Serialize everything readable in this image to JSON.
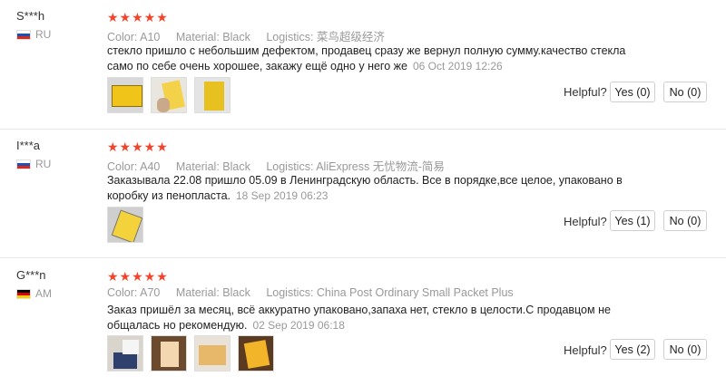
{
  "reviews": [
    {
      "buyer": "S***h",
      "country": "RU",
      "stars": "★★★★★",
      "color": "Color: A10",
      "material": "Material: Black",
      "logistics": "Logistics: 菜鸟超级经济",
      "text": "стекло пришло с небольшим дефектом, продавец сразу же вернул полную сумму.качество стекла само по себе очень хорошее, закажу ещё одно у него же",
      "date": "06 Oct 2019 12:26",
      "helpful": "Helpful?",
      "yes": "Yes (0)",
      "no": "No (0)"
    },
    {
      "buyer": "I***a",
      "country": "RU",
      "stars": "★★★★★",
      "color": "Color: A40",
      "material": "Material: Black",
      "logistics": "Logistics: AliExpress 无忧物流-简易",
      "text": "Заказывала 22.08 пришло 05.09 в Ленинградскую область. Все в порядке,все целое, упаковано в коробку из пенопласта.",
      "date": "18 Sep 2019 06:23",
      "helpful": "Helpful?",
      "yes": "Yes (1)",
      "no": "No (0)"
    },
    {
      "buyer": "G***n",
      "country": "AM",
      "stars": "★★★★★",
      "color": "Color: A70",
      "material": "Material: Black",
      "logistics": "Logistics: China Post Ordinary Small Packet Plus",
      "text": "Заказ пришёл за месяц, всё аккуратно упаковано,запаха нет, стекло в целости.С продавцом не общалась но рекомендую.",
      "date": "02 Sep 2019 06:18",
      "helpful": "Helpful?",
      "yes": "Yes (2)",
      "no": "No (0)"
    }
  ]
}
